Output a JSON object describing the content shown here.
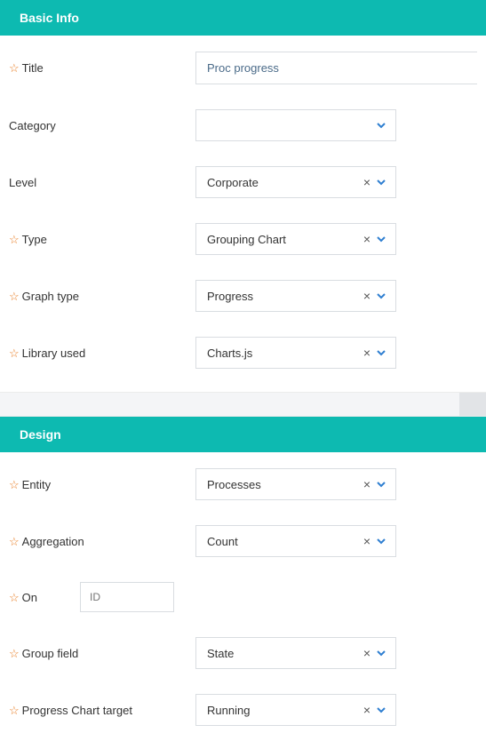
{
  "sections": {
    "basic": {
      "title": "Basic Info"
    },
    "design": {
      "title": "Design"
    }
  },
  "basic": {
    "title_label": "Title",
    "title_value": "Proc progress",
    "category_label": "Category",
    "category_value": "",
    "level_label": "Level",
    "level_value": "Corporate",
    "type_label": "Type",
    "type_value": "Grouping Chart",
    "graph_type_label": "Graph type",
    "graph_type_value": "Progress",
    "library_label": "Library used",
    "library_value": "Charts.js"
  },
  "design": {
    "entity_label": "Entity",
    "entity_value": "Processes",
    "aggregation_label": "Aggregation",
    "aggregation_value": "Count",
    "on_label": "On",
    "on_placeholder": "ID",
    "group_field_label": "Group field",
    "group_field_value": "State",
    "target_label": "Progress Chart target",
    "target_value": "Running"
  },
  "icons": {
    "clear": "×"
  }
}
